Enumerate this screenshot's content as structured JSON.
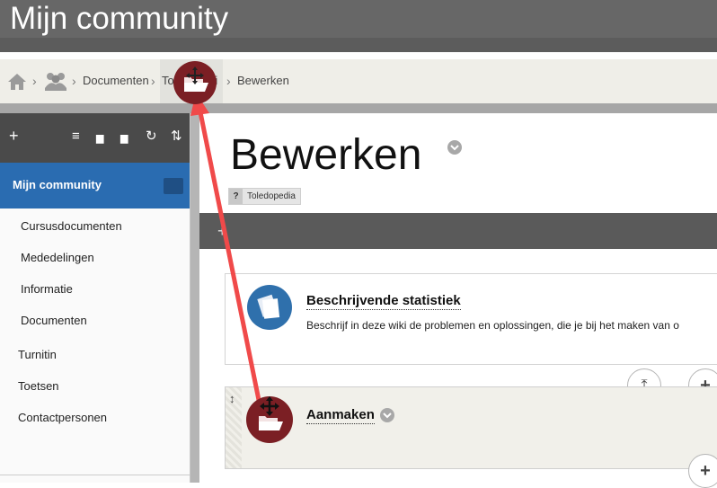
{
  "app": {
    "title": "Mijn community"
  },
  "breadcrumb": {
    "items": [
      "Documenten",
      "To",
      "iki",
      "Bewerken"
    ],
    "separator": "›"
  },
  "sidebar": {
    "toolbar": {
      "add": "+",
      "list": "≡",
      "folder": "▆",
      "folders": "▆",
      "refresh": "↻",
      "sort": "⇅"
    },
    "active_item": "Mijn community",
    "sub_items": [
      "Cursusdocumenten",
      "Mededelingen",
      "Informatie",
      "Documenten"
    ],
    "items": [
      "Turnitin",
      "Toetsen",
      "Contactpersonen"
    ]
  },
  "page": {
    "title": "Bewerken",
    "tag": {
      "icon": "?",
      "label": "Toledopedia"
    }
  },
  "bar": {
    "plus": "+"
  },
  "card1": {
    "title": "Beschrijvende statistiek",
    "description": "Beschrijf in deze wiki de problemen en oplossingen, die je bij het maken van o"
  },
  "controls": {
    "top": "⤒",
    "add1": "+",
    "add2": "+"
  },
  "card2": {
    "title": "Aanmaken",
    "drag": "↕"
  },
  "colors": {
    "accent": "#2a6cb1",
    "topbar": "#676767",
    "drag_icon": "#7b1f24",
    "arrow": "#f04a4a"
  }
}
